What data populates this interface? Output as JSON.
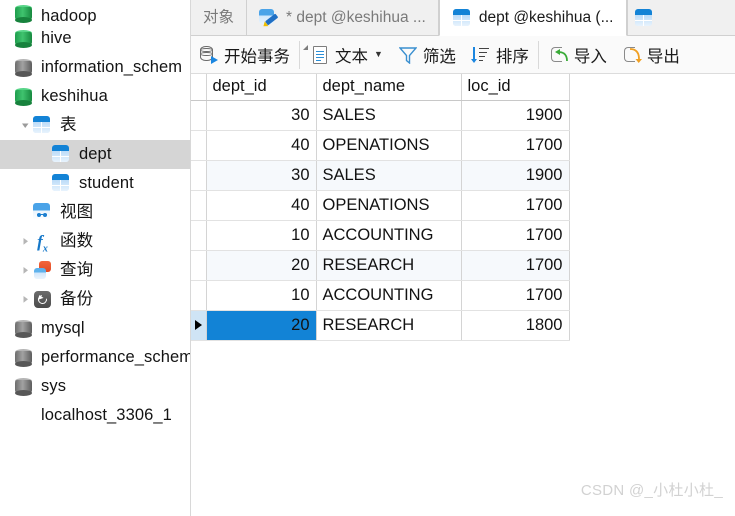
{
  "sidebar": {
    "items": [
      {
        "label": "hadoop",
        "icon": "database-icon",
        "indent": 0,
        "expander": "none",
        "selected": false,
        "clipped": true
      },
      {
        "label": "hive",
        "icon": "database-icon",
        "indent": 0,
        "expander": "none",
        "selected": false
      },
      {
        "label": "information_schem",
        "icon": "database-gray-icon",
        "indent": 0,
        "expander": "none",
        "selected": false
      },
      {
        "label": "keshihua",
        "icon": "database-icon",
        "indent": 0,
        "expander": "none",
        "selected": false
      },
      {
        "label": "表",
        "icon": "table-icon",
        "indent": 1,
        "expander": "expanded",
        "selected": false
      },
      {
        "label": "dept",
        "icon": "table-icon",
        "indent": 2,
        "expander": "none",
        "selected": true
      },
      {
        "label": "student",
        "icon": "table-icon",
        "indent": 2,
        "expander": "none",
        "selected": false
      },
      {
        "label": "视图",
        "icon": "view-icon",
        "indent": 1,
        "expander": "none",
        "selected": false
      },
      {
        "label": "函数",
        "icon": "function-icon",
        "indent": 1,
        "expander": "collapsed",
        "selected": false
      },
      {
        "label": "查询",
        "icon": "query-icon",
        "indent": 1,
        "expander": "collapsed",
        "selected": false
      },
      {
        "label": "备份",
        "icon": "backup-icon",
        "indent": 1,
        "expander": "collapsed",
        "selected": false
      },
      {
        "label": "mysql",
        "icon": "database-gray-icon",
        "indent": 0,
        "expander": "none",
        "selected": false
      },
      {
        "label": "performance_schem",
        "icon": "database-gray-icon",
        "indent": 0,
        "expander": "none",
        "selected": false
      },
      {
        "label": "sys",
        "icon": "database-gray-icon",
        "indent": 0,
        "expander": "none",
        "selected": false
      },
      {
        "label": "localhost_3306_1",
        "icon": "none",
        "indent": 0,
        "expander": "none",
        "selected": false
      }
    ]
  },
  "tabs": [
    {
      "label": "对象",
      "icon": "none",
      "active": false
    },
    {
      "label": "* dept @keshihua ...",
      "icon": "edit-icon",
      "active": false
    },
    {
      "label": "dept @keshihua (...",
      "icon": "table-icon",
      "active": true
    },
    {
      "label": "",
      "icon": "table-icon",
      "active": false
    }
  ],
  "toolbar": {
    "buttons": [
      {
        "label": "开始事务",
        "icon": "transaction-icon",
        "caret": false
      },
      {
        "label": "文本",
        "icon": "text-icon",
        "caret": true
      },
      {
        "label": "筛选",
        "icon": "filter-icon",
        "caret": false
      },
      {
        "label": "排序",
        "icon": "sort-icon",
        "caret": false
      },
      {
        "label": "导入",
        "icon": "import-icon",
        "caret": false
      },
      {
        "label": "导出",
        "icon": "export-icon",
        "caret": false
      }
    ]
  },
  "grid": {
    "columns": [
      "dept_id",
      "dept_name",
      "loc_id"
    ],
    "highlighted_column": "dept_id",
    "rows": [
      {
        "dept_id": "30",
        "dept_name": "SALES",
        "loc_id": "1900"
      },
      {
        "dept_id": "40",
        "dept_name": "OPENATIONS",
        "loc_id": "1700"
      },
      {
        "dept_id": "30",
        "dept_name": "SALES",
        "loc_id": "1900"
      },
      {
        "dept_id": "40",
        "dept_name": "OPENATIONS",
        "loc_id": "1700"
      },
      {
        "dept_id": "10",
        "dept_name": "ACCOUNTING",
        "loc_id": "1700"
      },
      {
        "dept_id": "20",
        "dept_name": "RESEARCH",
        "loc_id": "1700"
      },
      {
        "dept_id": "10",
        "dept_name": "ACCOUNTING",
        "loc_id": "1700"
      },
      {
        "dept_id": "20",
        "dept_name": "RESEARCH",
        "loc_id": "1800"
      }
    ],
    "selected_row_index": 7,
    "selected_column": "dept_id"
  },
  "watermark": {
    "text": "CSDN @_小杜小杜_"
  },
  "colors": {
    "accent": "#1283d6",
    "header_highlight": "#d9eaf7",
    "sidebar_selection": "#d5d5d5",
    "alt_row": "#f6f9fc"
  }
}
